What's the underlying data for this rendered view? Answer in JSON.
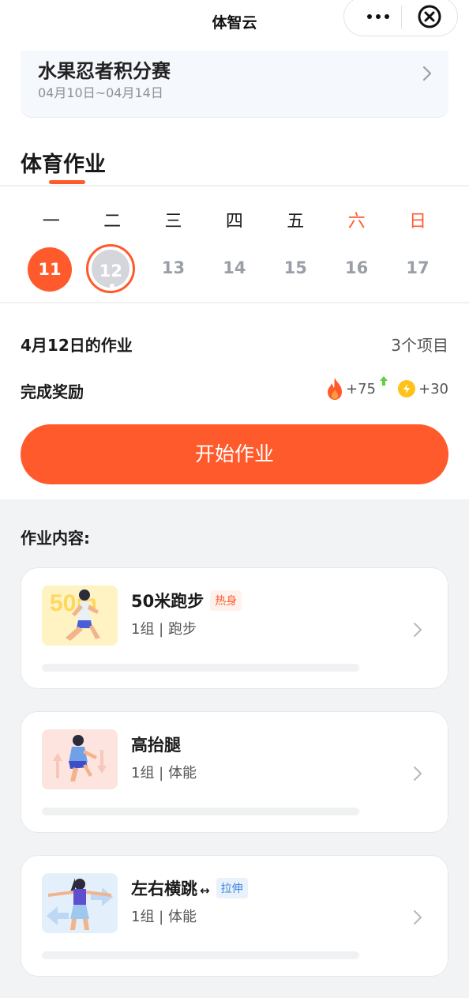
{
  "header": {
    "title": "体智云"
  },
  "contest": {
    "title": "水果忍者积分赛",
    "dates": "04月10日~04月14日"
  },
  "section": {
    "title": "体育作业"
  },
  "calendar": {
    "weekdays": [
      "一",
      "二",
      "三",
      "四",
      "五",
      "六",
      "日"
    ],
    "dates": [
      "11",
      "12",
      "13",
      "14",
      "15",
      "16",
      "17"
    ],
    "completed_index": 0,
    "selected_index": 1
  },
  "homework": {
    "date_label": "4月12日的作业",
    "count_label": "3个项目",
    "reward_label": "完成奖励",
    "fire_reward": "+75",
    "coin_reward": "+30",
    "start_label": "开始作业"
  },
  "content": {
    "label": "作业内容:",
    "items": [
      {
        "name": "50米跑步",
        "tag": "热身",
        "detail": "1组 | 跑步",
        "thumb_text": "50m"
      },
      {
        "name": "高抬腿",
        "tag": "",
        "detail": "1组 | 体能"
      },
      {
        "name": "左右横跳",
        "arrow": "↔",
        "tag": "拉伸",
        "detail": "1组 | 体能"
      }
    ]
  },
  "colors": {
    "accent": "#ff5a2b",
    "stretch_tag": "#3d86e0",
    "coin": "#ffc21a",
    "bg": "#f2f3f5"
  }
}
